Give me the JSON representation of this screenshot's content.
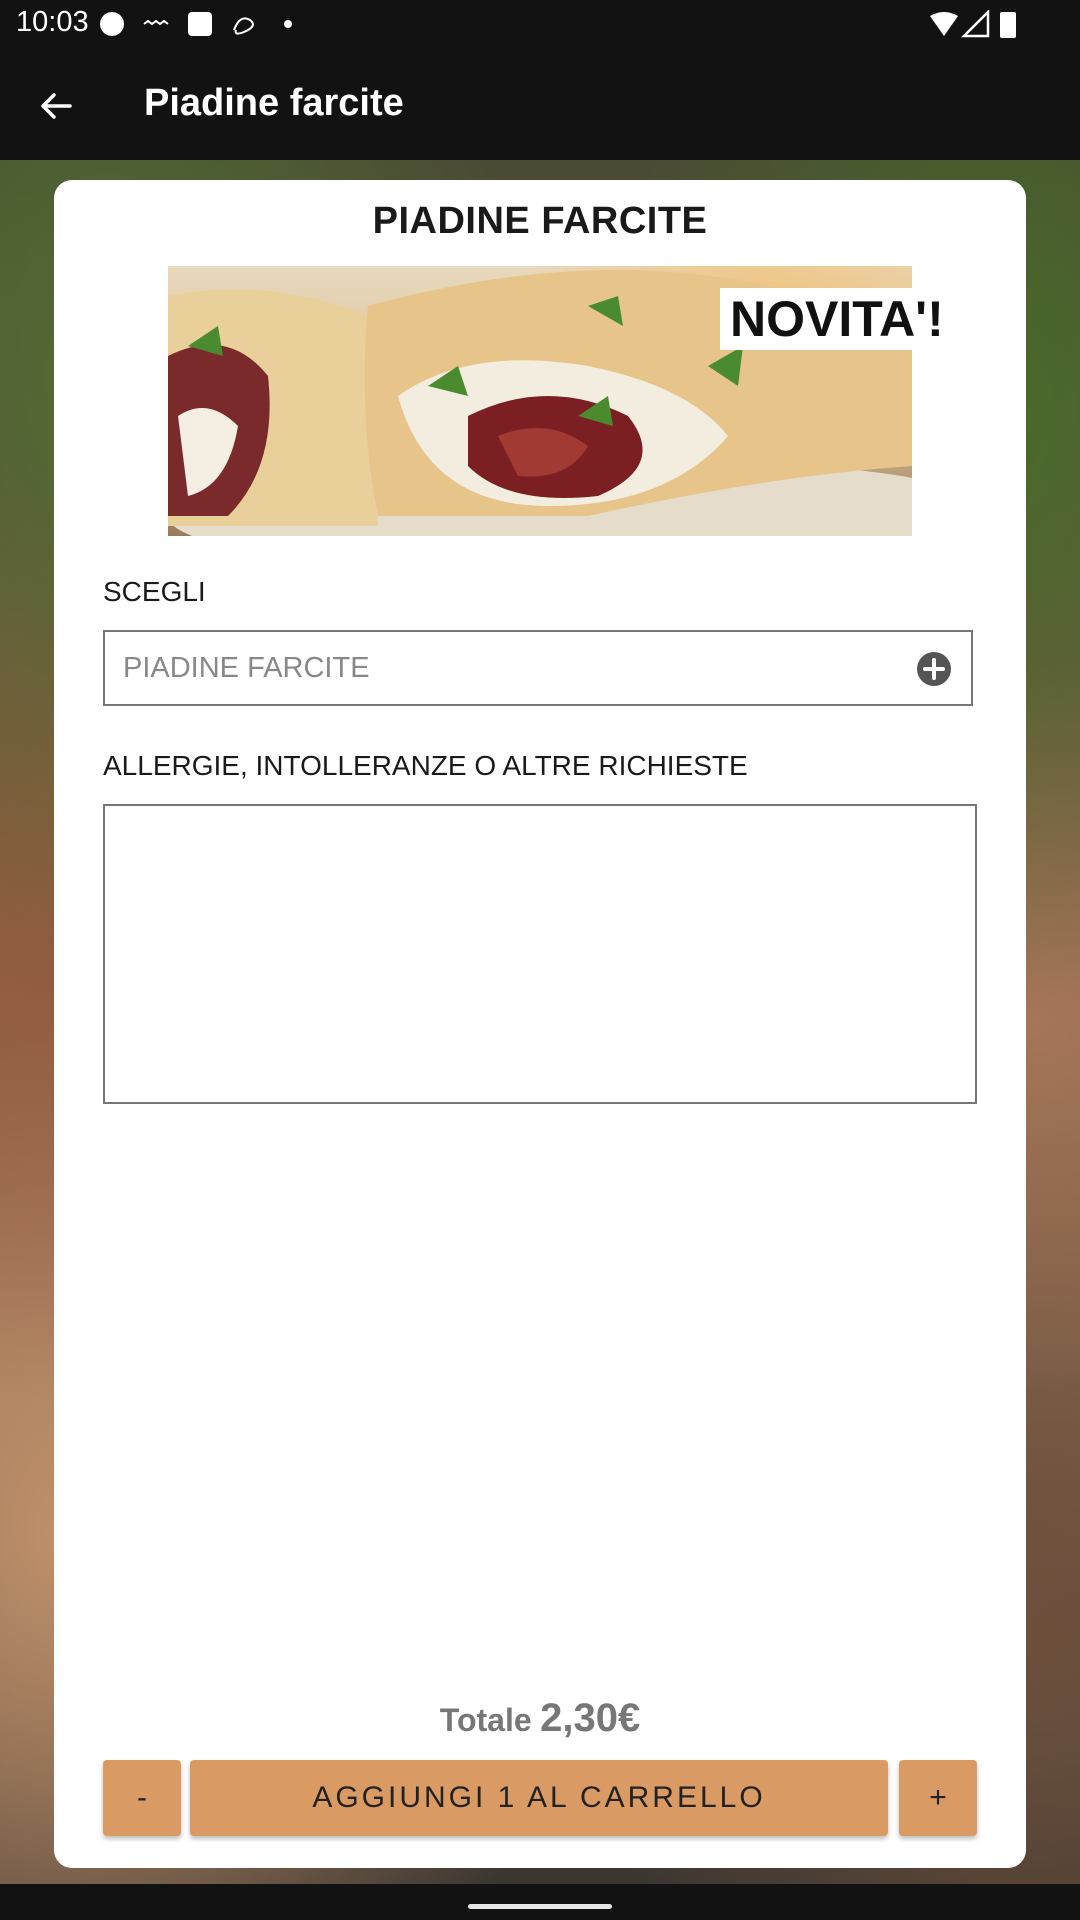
{
  "status_bar": {
    "time": "10:03"
  },
  "app_bar": {
    "title": "Piadine farcite",
    "back_icon": "arrow-left-icon"
  },
  "product": {
    "title": "PIADINE FARCITE",
    "badge": "NOVITA'!"
  },
  "form": {
    "choose_label": "SCEGLI",
    "choose_value": "PIADINE FARCITE",
    "allergies_label": "ALLERGIE, INTOLLERANZE O ALTRE RICHIESTE",
    "allergies_value": ""
  },
  "total": {
    "label": "Totale",
    "value": "2,30€"
  },
  "actions": {
    "minus_label": "-",
    "add_label": "AGGIUNGI 1 AL CARRELLO",
    "plus_label": "+"
  },
  "colors": {
    "accent": "#d99a64",
    "bar": "#121212"
  }
}
